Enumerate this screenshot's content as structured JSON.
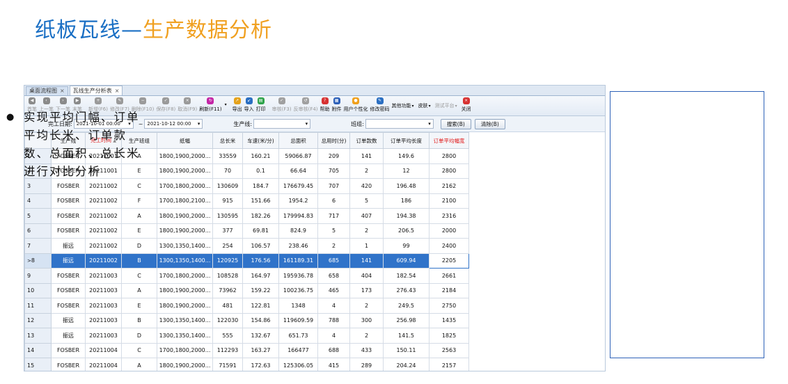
{
  "title": {
    "part1": "纸板瓦线",
    "dash": "—",
    "part2": "生产数据分析"
  },
  "tabs": [
    {
      "label": "桌面流程图",
      "close": "×"
    },
    {
      "label": "瓦线生产分析表",
      "close": "×"
    }
  ],
  "toolbar": {
    "first": "首笔",
    "prev": "上一笔",
    "next": "下一笔",
    "last": "末笔",
    "add": "新增(F6)",
    "edit": "修改(F7)",
    "delete": "删除(F10)",
    "save": "保存(F8)",
    "cancel": "取消(F9)",
    "refresh": "刷新(F11)",
    "export": "导出",
    "import": "导入",
    "print": "打印",
    "audit": "审核(F3)",
    "unaudit": "反审核(F4)",
    "help": "帮助",
    "attach": "附件",
    "personalize": "用户个性化",
    "password": "修改密码",
    "other": "其他功能",
    "skin": "皮肤",
    "test_platform": "测试平台",
    "close": "关闭"
  },
  "filter": {
    "date_label": "完工日期:",
    "date_from": "2021-10-01 00:00",
    "date_sep": "~",
    "date_to": "2021-10-12 00:00",
    "line_label": "生产线:",
    "line_value": "",
    "team_label": "班组:",
    "team_value": "",
    "search_button": "搜索(B)",
    "clear_button": "清除(B)"
  },
  "table": {
    "columns": [
      "生产线",
      "完工时间",
      "生产班组",
      "纸幅",
      "总长米",
      "车速(米/分)",
      "总面积",
      "总用时(分)",
      "订单款数",
      "订单平均长度",
      "订单平均幅宽"
    ],
    "rows": [
      [
        "1",
        "FOSBER",
        "20211001",
        "A",
        "1800,1900,2000...",
        "33559",
        "160.21",
        "59066.87",
        "209",
        "141",
        "149.6",
        "2800"
      ],
      [
        "2",
        "FOSBER",
        "20211001",
        "E",
        "1800,1900,2000...",
        "70",
        "0.1",
        "66.64",
        "705",
        "2",
        "12",
        "2800"
      ],
      [
        "3",
        "FOSBER",
        "20211002",
        "C",
        "1700,1800,2000...",
        "130609",
        "184.7",
        "176679.45",
        "707",
        "420",
        "196.48",
        "2162"
      ],
      [
        "4",
        "FOSBER",
        "20211002",
        "F",
        "1700,1800,2100...",
        "915",
        "151.66",
        "1954.2",
        "6",
        "5",
        "186",
        "2100"
      ],
      [
        "5",
        "FOSBER",
        "20211002",
        "A",
        "1800,1900,2000...",
        "130595",
        "182.26",
        "179994.83",
        "717",
        "407",
        "194.38",
        "2316"
      ],
      [
        "6",
        "FOSBER",
        "20211002",
        "E",
        "1800,1900,2000...",
        "377",
        "69.81",
        "824.9",
        "5",
        "2",
        "206.5",
        "2000"
      ],
      [
        "7",
        "振远",
        "20211002",
        "D",
        "1300,1350,1400...",
        "254",
        "106.57",
        "238.46",
        "2",
        "1",
        "99",
        "2400"
      ],
      [
        "8",
        "振远",
        "20211002",
        "B",
        "1300,1350,1400...",
        "120925",
        "176.56",
        "161189.31",
        "685",
        "141",
        "609.94",
        "2205"
      ],
      [
        "9",
        "FOSBER",
        "20211003",
        "C",
        "1700,1800,2000...",
        "108528",
        "164.97",
        "195936.78",
        "658",
        "404",
        "182.54",
        "2661"
      ],
      [
        "10",
        "FOSBER",
        "20211003",
        "A",
        "1800,1900,2000...",
        "73962",
        "159.22",
        "100236.75",
        "465",
        "173",
        "276.43",
        "2184"
      ],
      [
        "11",
        "FOSBER",
        "20211003",
        "E",
        "1800,1900,2000...",
        "481",
        "122.81",
        "1348",
        "4",
        "2",
        "249.5",
        "2750"
      ],
      [
        "12",
        "振远",
        "20211003",
        "B",
        "1300,1350,1400...",
        "122030",
        "154.86",
        "119609.59",
        "788",
        "300",
        "256.98",
        "1435"
      ],
      [
        "13",
        "振远",
        "20211003",
        "D",
        "1300,1350,1400...",
        "555",
        "132.67",
        "651.73",
        "4",
        "2",
        "141.5",
        "1825"
      ],
      [
        "14",
        "FOSBER",
        "20211004",
        "C",
        "1700,1800,2000...",
        "112293",
        "163.27",
        "166477",
        "688",
        "433",
        "150.11",
        "2563"
      ],
      [
        "15",
        "FOSBER",
        "20211004",
        "A",
        "1800,1900,2000...",
        "71591",
        "172.63",
        "125306.05",
        "415",
        "289",
        "204.24",
        "2157"
      ]
    ],
    "selected_row_marker": ">"
  },
  "side_note": {
    "bullet": "●",
    "text": "实现平均门幅、订单平均长米、订单款数、总面积、总长米进行对比分析"
  },
  "colors": {
    "title_blue": "#1a6fc4",
    "title_orange": "#f0a020",
    "selected_row": "#3073c9",
    "red_header": "#e01515"
  }
}
